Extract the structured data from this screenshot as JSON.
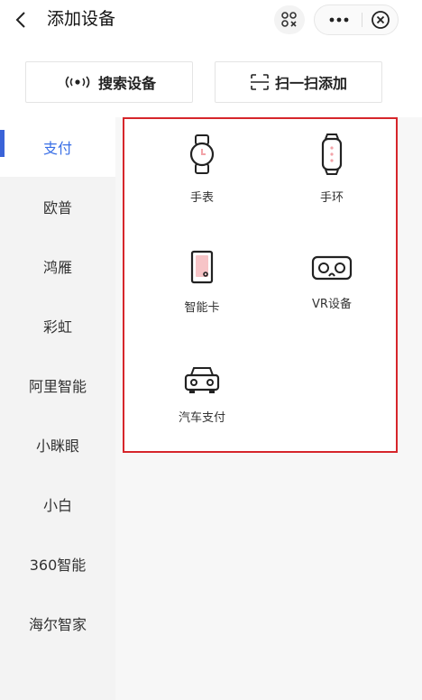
{
  "header": {
    "title": "添加设备"
  },
  "actions": {
    "search_label": "搜索设备",
    "scan_add_label": "扫一扫添加"
  },
  "sidebar": {
    "items": [
      {
        "label": "支付",
        "active": true
      },
      {
        "label": "欧普"
      },
      {
        "label": "鸿雁"
      },
      {
        "label": "彩虹"
      },
      {
        "label": "阿里智能"
      },
      {
        "label": "小眯眼"
      },
      {
        "label": "小白"
      },
      {
        "label": "360智能"
      },
      {
        "label": "海尔智家"
      }
    ]
  },
  "devices": [
    {
      "label": "手表",
      "icon": "watch-icon"
    },
    {
      "label": "手环",
      "icon": "band-icon"
    },
    {
      "label": "智能卡",
      "icon": "card-icon"
    },
    {
      "label": "VR设备",
      "icon": "vr-icon"
    },
    {
      "label": "汽车支付",
      "icon": "car-icon"
    }
  ],
  "colors": {
    "accent": "#3a6fe6",
    "highlight_border": "#d6262b",
    "icon_pink": "#f2a3a8"
  }
}
